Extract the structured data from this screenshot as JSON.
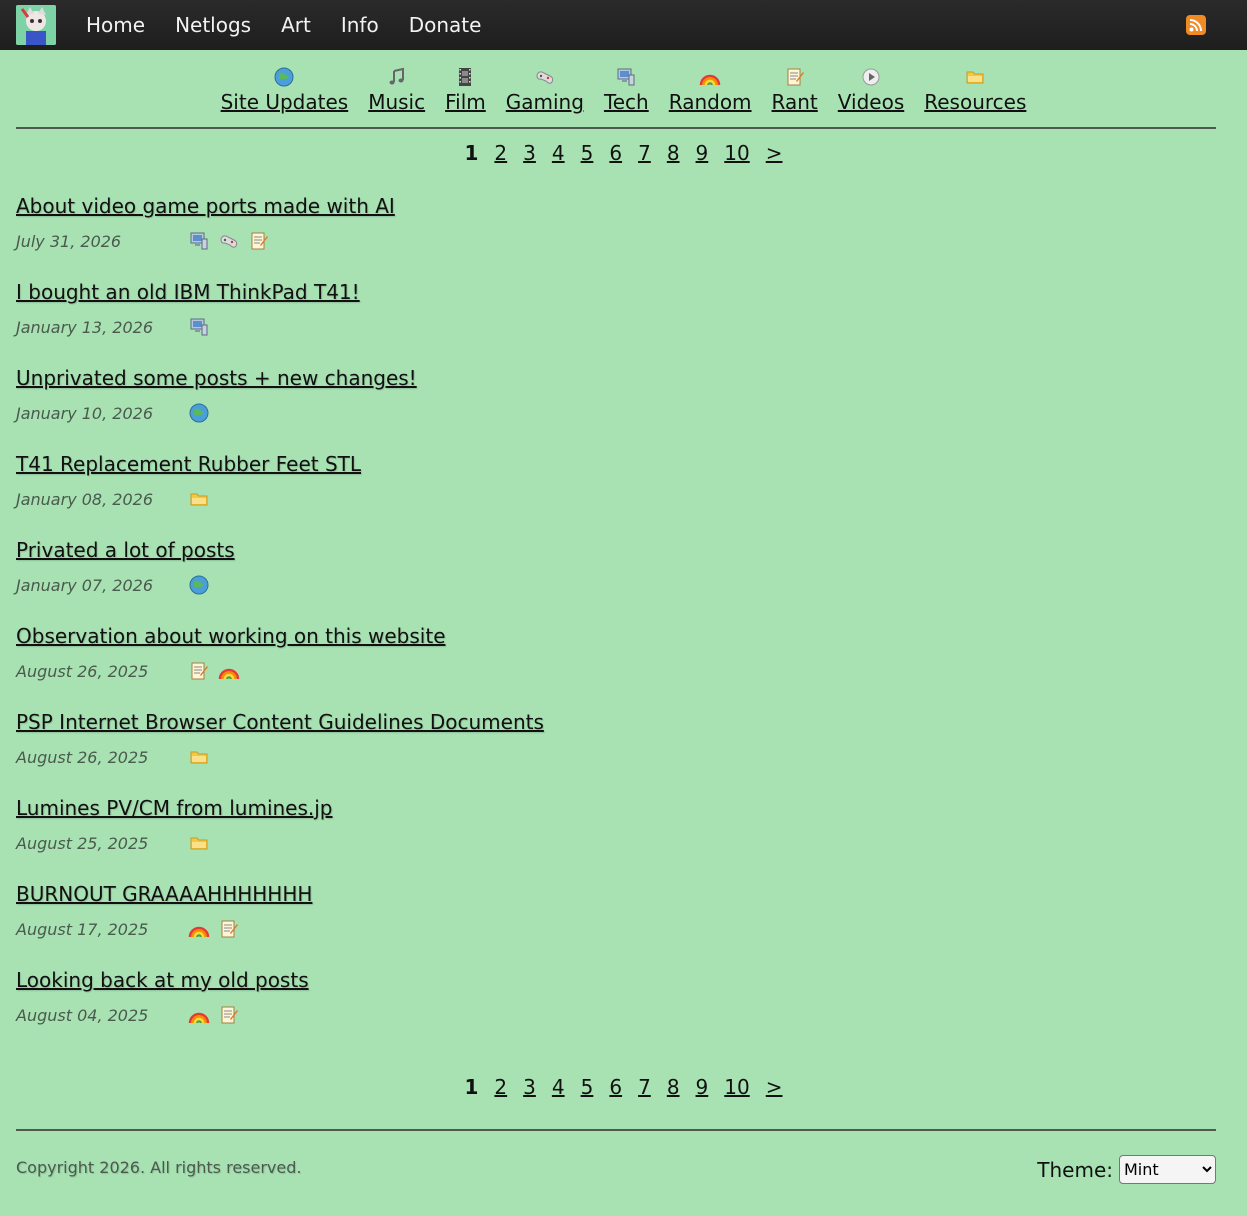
{
  "nav": {
    "items": [
      "Home",
      "Netlogs",
      "Art",
      "Info",
      "Donate"
    ]
  },
  "categories": [
    {
      "label": "Site Updates",
      "icon": "globe-icon"
    },
    {
      "label": "Music",
      "icon": "music-note-icon"
    },
    {
      "label": "Film",
      "icon": "film-strip-icon"
    },
    {
      "label": "Gaming",
      "icon": "gamepad-icon"
    },
    {
      "label": "Tech",
      "icon": "computer-icon"
    },
    {
      "label": "Random",
      "icon": "rainbow-icon"
    },
    {
      "label": "Rant",
      "icon": "notepad-icon"
    },
    {
      "label": "Videos",
      "icon": "play-icon"
    },
    {
      "label": "Resources",
      "icon": "folder-icon"
    }
  ],
  "pager": {
    "pages": [
      "1",
      "2",
      "3",
      "4",
      "5",
      "6",
      "7",
      "8",
      "9",
      "10"
    ],
    "current": "1",
    "next": ">"
  },
  "posts": [
    {
      "title": "About video game ports made with AI",
      "date": "July 31, 2026",
      "tags": [
        "computer-icon",
        "gamepad-icon",
        "notepad-icon"
      ]
    },
    {
      "title": "I bought an old IBM ThinkPad T41!",
      "date": "January 13, 2026",
      "tags": [
        "computer-icon"
      ]
    },
    {
      "title": "Unprivated some posts + new changes!",
      "date": "January 10, 2026",
      "tags": [
        "globe-icon"
      ]
    },
    {
      "title": "T41 Replacement Rubber Feet STL",
      "date": "January 08, 2026",
      "tags": [
        "folder-icon"
      ]
    },
    {
      "title": "Privated a lot of posts",
      "date": "January 07, 2026",
      "tags": [
        "globe-icon"
      ]
    },
    {
      "title": "Observation about working on this website",
      "date": "August 26, 2025",
      "tags": [
        "notepad-icon",
        "rainbow-icon"
      ]
    },
    {
      "title": "PSP Internet Browser Content Guidelines Documents",
      "date": "August 26, 2025",
      "tags": [
        "folder-icon"
      ]
    },
    {
      "title": "Lumines PV/CM from lumines.jp",
      "date": "August 25, 2025",
      "tags": [
        "folder-icon"
      ]
    },
    {
      "title": "BURNOUT GRAAAAHHHHHHH",
      "date": "August 17, 2025",
      "tags": [
        "rainbow-icon",
        "notepad-icon"
      ]
    },
    {
      "title": "Looking back at my old posts",
      "date": "August 04, 2025",
      "tags": [
        "rainbow-icon",
        "notepad-icon"
      ]
    }
  ],
  "footer": {
    "copyright": "Copyright 2026. All rights reserved.",
    "theme_label": "Theme:",
    "theme_selected": "Mint"
  },
  "colors": {
    "background": "#a8e2b3",
    "topbar": "#222222",
    "rss": "#f08a24"
  }
}
